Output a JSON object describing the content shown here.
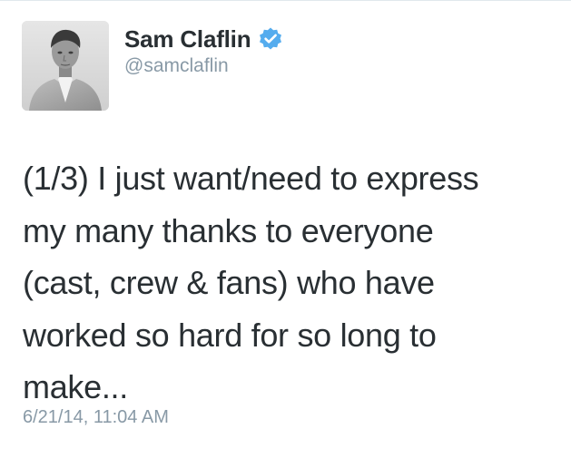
{
  "tweet": {
    "author": {
      "display_name": "Sam Claflin",
      "handle": "@samclaflin",
      "verified": true,
      "verified_icon": "verified-badge-icon",
      "avatar_icon": "avatar-photo"
    },
    "text": "(1/3) I just want/need to express\nmy many thanks to everyone\n(cast, crew & fans) who have\nworked so hard for so long to\nmake...",
    "timestamp": "6/21/14, 11:04 AM"
  },
  "colors": {
    "text": "#292f33",
    "secondary_text": "#8899a6",
    "verified_blue": "#55acee"
  }
}
